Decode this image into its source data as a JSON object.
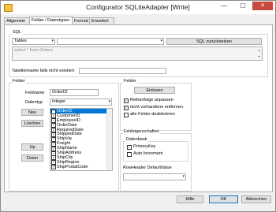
{
  "window": {
    "title": "Configurator SQLiteAdapter [Write]"
  },
  "controls": {
    "minimize": "—",
    "maximize": "☐",
    "close": "✕"
  },
  "tabs": [
    "Allgemein",
    "Felder / Datentypen",
    "Format",
    "Erweitert"
  ],
  "sql": {
    "group_label": "SQL",
    "tables_combo": "Tables",
    "button": "SQL zurücksetzen",
    "query": "select * from Orders",
    "tablename_label": "Tabellenname falls nicht existiert"
  },
  "felder": {
    "group_label": "Felder",
    "feldname_label": "Feldname",
    "feldname_value": "OrderID",
    "datentyp_label": "Datentyp",
    "datentyp_value": "Integer",
    "buttons": {
      "neu": "Neu",
      "loeschen": "Löschen",
      "up": "Up",
      "down": "Down"
    },
    "list": [
      "OrderID",
      "CustomerID",
      "EmployeeID",
      "OrderDate",
      "RequiredDate",
      "ShippedDate",
      "ShipVia",
      "Freight",
      "ShipName",
      "ShipAddress",
      "ShipCity",
      "ShipRegion",
      "ShipPostalCode"
    ]
  },
  "felder_right": {
    "group_label": "Felder",
    "einlesen": "Einlesen",
    "options": [
      "Reihenfolge anpassen",
      "nicht vorhandene entfernen",
      "alle Felder deaktivieren"
    ],
    "options_checked": [
      true,
      true,
      false
    ]
  },
  "feldeigenschaften": {
    "group_label": "Feldeigenschaften",
    "datenbank_label": "Datenbank",
    "options": [
      "PrimaryKey",
      "Auto Increment"
    ],
    "options_checked": [
      true,
      false
    ],
    "default_label": "RowHeader DefaultValue"
  },
  "footer": {
    "hilfe": "Hilfe",
    "ok": "OK",
    "abbrechen": "Abbrechen"
  }
}
